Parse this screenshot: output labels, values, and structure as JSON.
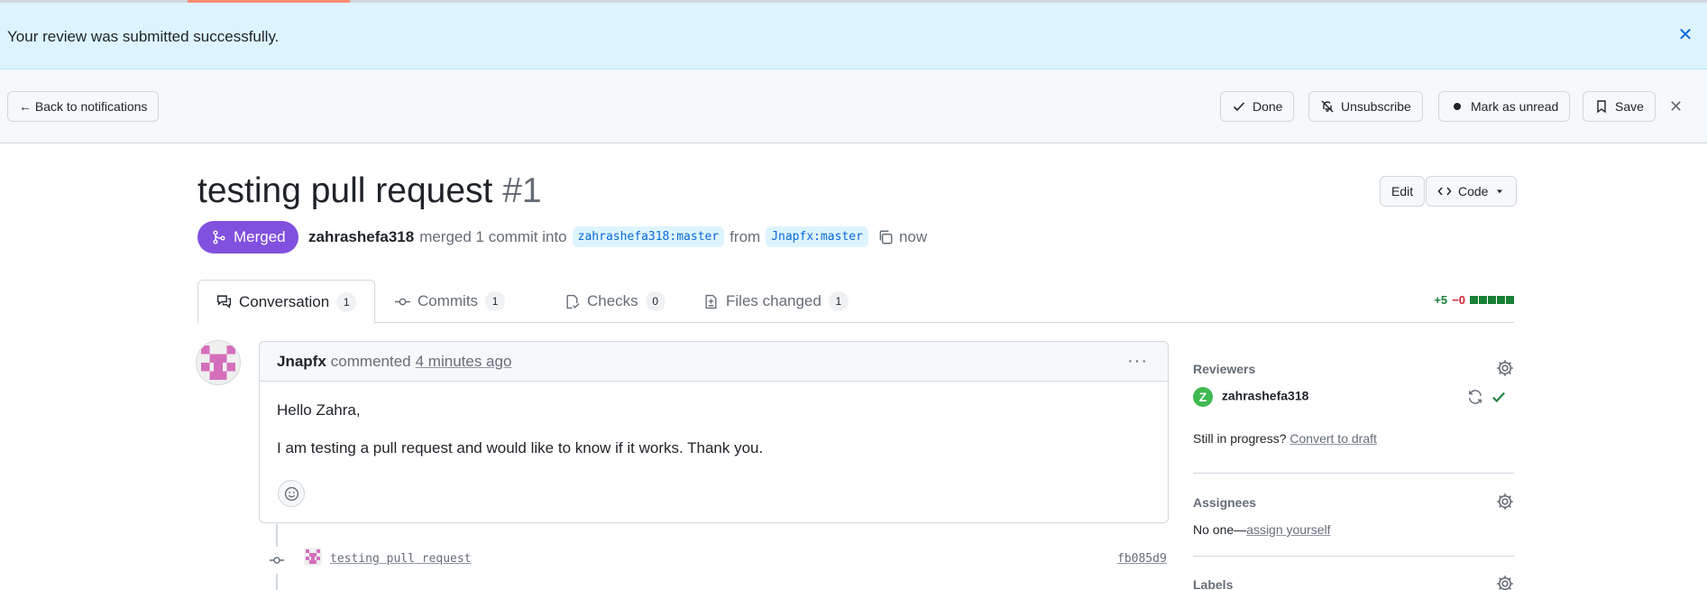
{
  "flash": {
    "message": "Your review was submitted successfully.",
    "close": "✕"
  },
  "notifications_bar": {
    "back": "← Back to notifications",
    "done": "Done",
    "unsubscribe": "Unsubscribe",
    "mark_unread": "Mark as unread",
    "save": "Save",
    "close": "✕"
  },
  "pr": {
    "title": "testing pull request",
    "number": "#1",
    "state": "Merged",
    "author": "zahrashefa318",
    "action": "merged 1 commit into",
    "base_branch": "zahrashefa318:master",
    "from_word": "from",
    "head_branch": "Jnapfx:master",
    "time": "now",
    "edit": "Edit",
    "code": "Code"
  },
  "tabs": [
    {
      "label": "Conversation",
      "count": "1"
    },
    {
      "label": "Commits",
      "count": "1"
    },
    {
      "label": "Checks",
      "count": "0"
    },
    {
      "label": "Files changed",
      "count": "1"
    }
  ],
  "diffstat": {
    "additions": "+5",
    "deletions": "−0"
  },
  "comment": {
    "author": "Jnapfx",
    "verb": "commented",
    "time": "4 minutes ago",
    "menu": "···",
    "line1": "Hello Zahra,",
    "line2": "I am testing a pull request and would like to know if it works. Thank you."
  },
  "commit": {
    "message": "testing pull request",
    "sha": "fb085d9"
  },
  "sidebar": {
    "reviewers": {
      "heading": "Reviewers",
      "reviewer": "zahrashefa318",
      "reviewer_initial": "Z",
      "draft_prompt": "Still in progress?",
      "draft_link": "Convert to draft"
    },
    "assignees": {
      "heading": "Assignees",
      "none": "No one—",
      "assign_link": "assign yourself"
    },
    "labels": {
      "heading": "Labels"
    }
  },
  "colors": {
    "merged": "#8250df",
    "flash_bg": "#ddf4ff",
    "link": "#0969da",
    "success": "#1a7f37",
    "danger": "#d1242f"
  }
}
